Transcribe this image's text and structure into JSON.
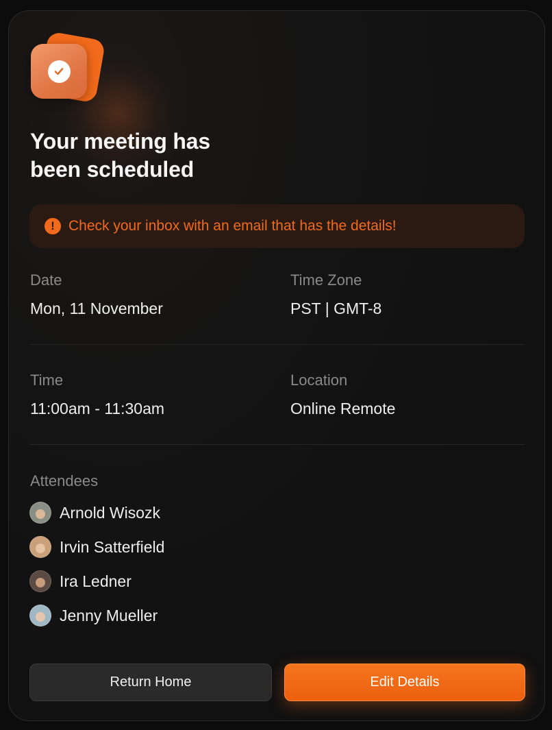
{
  "header": {
    "title": "Your meeting has been scheduled",
    "badge_icon": "check-circle-icon"
  },
  "alert": {
    "icon": "exclamation-circle-icon",
    "text": "Check your inbox with an email that has the details!",
    "color": "#f26a1b"
  },
  "details": {
    "date": {
      "label": "Date",
      "value": "Mon, 11 November"
    },
    "timezone": {
      "label": "Time Zone",
      "value": "PST | GMT-8"
    },
    "time": {
      "label": "Time",
      "value": "11:00am - 11:30am"
    },
    "location": {
      "label": "Location",
      "value": "Online Remote"
    }
  },
  "attendees": {
    "label": "Attendees",
    "list": [
      {
        "name": "Arnold Wisozk"
      },
      {
        "name": "Irvin Satterfield"
      },
      {
        "name": "Ira Ledner"
      },
      {
        "name": "Jenny Mueller"
      }
    ]
  },
  "actions": {
    "return_home": "Return Home",
    "edit_details": "Edit Details"
  },
  "colors": {
    "accent": "#f26a1b",
    "background": "#111111"
  }
}
